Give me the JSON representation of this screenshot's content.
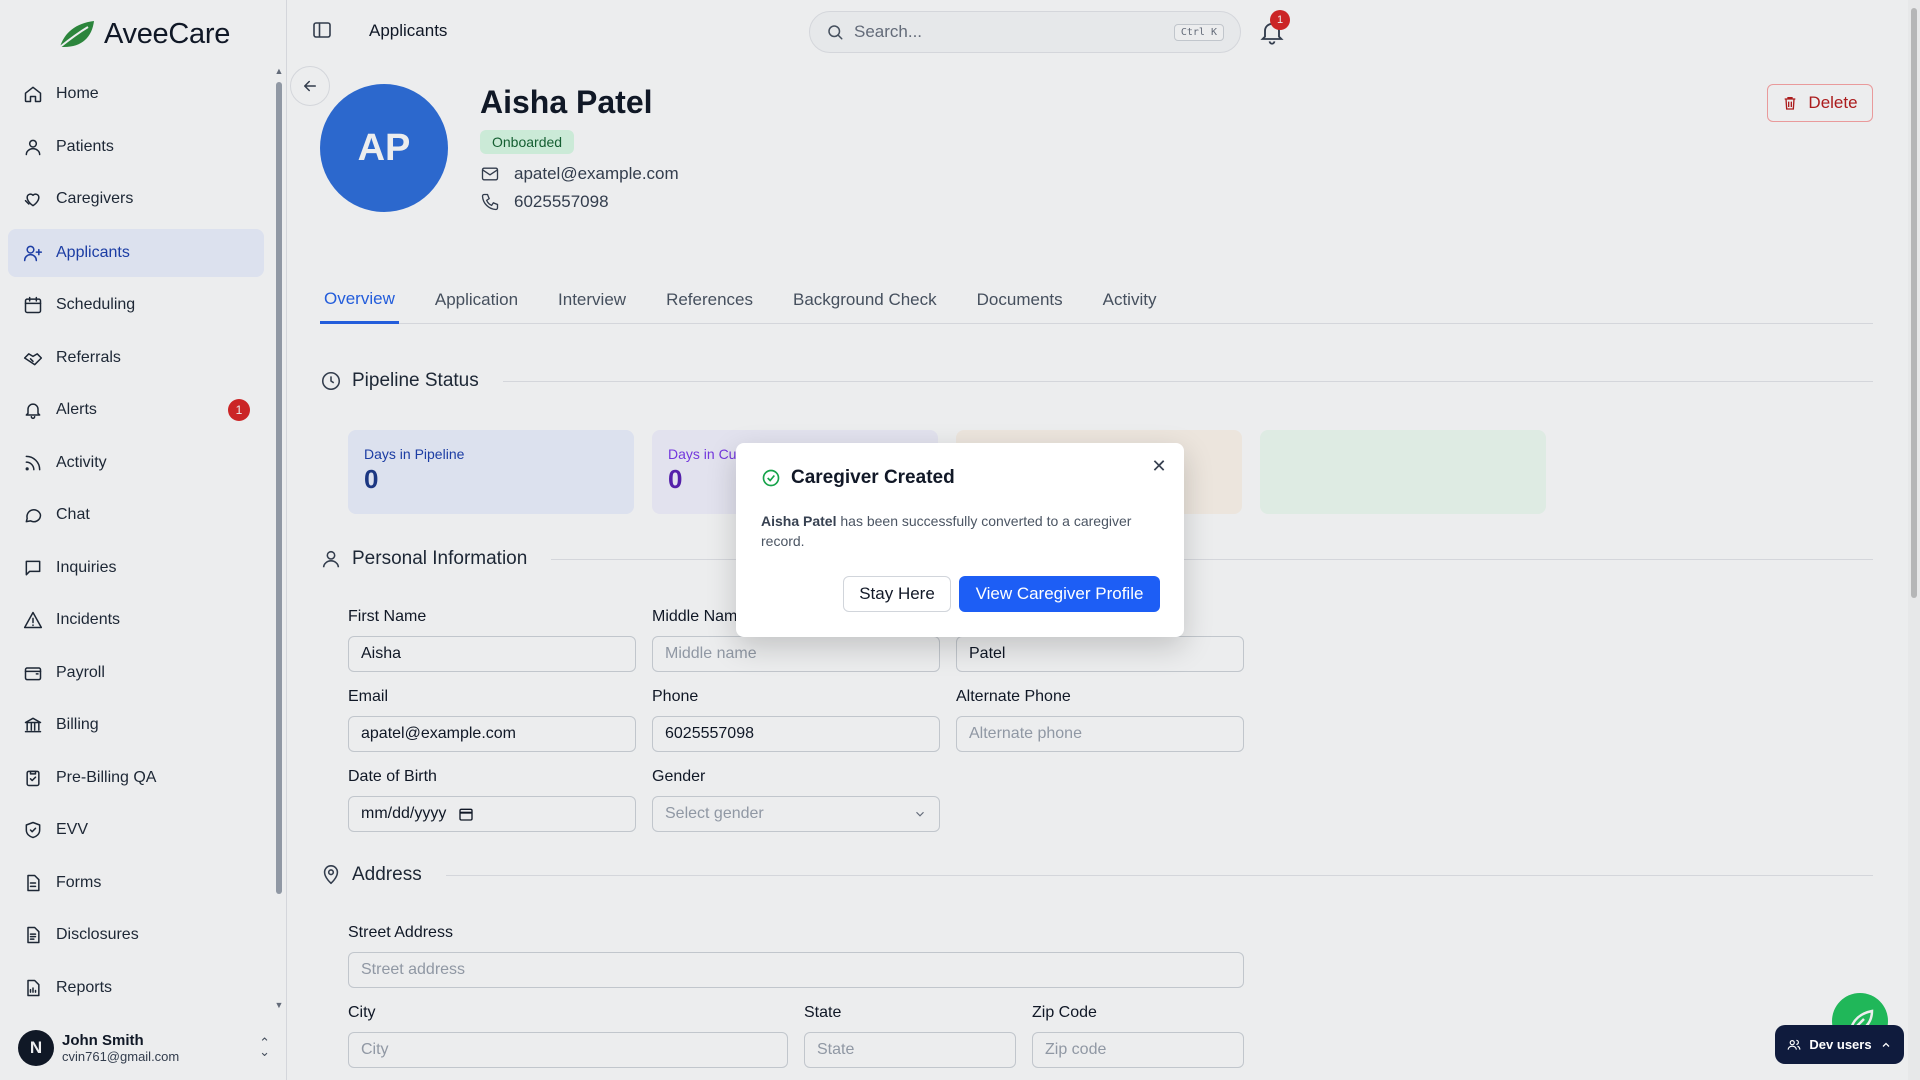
{
  "app": {
    "name": "AveeCare"
  },
  "sidebar": {
    "items": [
      {
        "label": "Home",
        "icon": "home-icon"
      },
      {
        "label": "Patients",
        "icon": "user-icon"
      },
      {
        "label": "Caregivers",
        "icon": "caregivers-icon"
      },
      {
        "label": "Applicants",
        "icon": "user-plus-icon",
        "active": true
      },
      {
        "label": "Scheduling",
        "icon": "calendar-icon"
      },
      {
        "label": "Referrals",
        "icon": "handshake-icon"
      },
      {
        "label": "Alerts",
        "icon": "bell-icon",
        "badge": "1"
      },
      {
        "label": "Activity",
        "icon": "rss-icon"
      },
      {
        "label": "Chat",
        "icon": "chat-icon"
      },
      {
        "label": "Inquiries",
        "icon": "message-square-icon"
      },
      {
        "label": "Incidents",
        "icon": "warning-icon"
      },
      {
        "label": "Payroll",
        "icon": "wallet-icon"
      },
      {
        "label": "Billing",
        "icon": "bank-icon"
      },
      {
        "label": "Pre-Billing QA",
        "icon": "clipboard-check-icon"
      },
      {
        "label": "EVV",
        "icon": "shield-check-icon"
      },
      {
        "label": "Forms",
        "icon": "file-text-icon"
      },
      {
        "label": "Disclosures",
        "icon": "file-list-icon"
      },
      {
        "label": "Reports",
        "icon": "file-chart-icon"
      }
    ],
    "user": {
      "initial": "N",
      "name": "John Smith",
      "email": "cvin761@gmail.com"
    }
  },
  "topbar": {
    "breadcrumb": "Applicants",
    "search_placeholder": "Search...",
    "search_shortcut": "Ctrl K",
    "notification_count": "1"
  },
  "profile": {
    "initials": "AP",
    "name": "Aisha Patel",
    "status": "Onboarded",
    "email": "apatel@example.com",
    "phone": "6025557098",
    "delete_label": "Delete"
  },
  "tabs": [
    {
      "label": "Overview",
      "active": true
    },
    {
      "label": "Application"
    },
    {
      "label": "Interview"
    },
    {
      "label": "References"
    },
    {
      "label": "Background Check"
    },
    {
      "label": "Documents"
    },
    {
      "label": "Activity"
    }
  ],
  "pipeline": {
    "title": "Pipeline Status",
    "stats": [
      {
        "label": "Days in Pipeline",
        "value": "0"
      },
      {
        "label": "Days in Cu",
        "value": "0"
      }
    ]
  },
  "personal": {
    "title": "Personal Information",
    "first_name": {
      "label": "First Name",
      "value": "Aisha"
    },
    "middle_name": {
      "label": "Middle Nam",
      "placeholder": "Middle name"
    },
    "last_name": {
      "value": "Patel"
    },
    "email": {
      "label": "Email",
      "value": "apatel@example.com"
    },
    "phone": {
      "label": "Phone",
      "value": "6025557098"
    },
    "alt_phone": {
      "label": "Alternate Phone",
      "placeholder": "Alternate phone"
    },
    "dob": {
      "label": "Date of Birth",
      "placeholder": "mm/dd/yyyy"
    },
    "gender": {
      "label": "Gender",
      "placeholder": "Select gender"
    }
  },
  "address": {
    "title": "Address",
    "street": {
      "label": "Street Address",
      "placeholder": "Street address"
    },
    "city": {
      "label": "City",
      "placeholder": "City"
    },
    "state": {
      "label": "State",
      "placeholder": "State"
    },
    "zip": {
      "label": "Zip Code",
      "placeholder": "Zip code"
    }
  },
  "dialog": {
    "title": "Caregiver Created",
    "name": "Aisha Patel",
    "message": "has been successfully converted to a caregiver record.",
    "stay_label": "Stay Here",
    "view_label": "View Caregiver Profile"
  },
  "dev_users": {
    "label": "Dev users"
  },
  "colors": {
    "accent": "#2563eb",
    "primary_button": "#1d5ef5",
    "success": "#16a34a",
    "danger": "#dc2626",
    "avatar": "#2f6fdc"
  }
}
